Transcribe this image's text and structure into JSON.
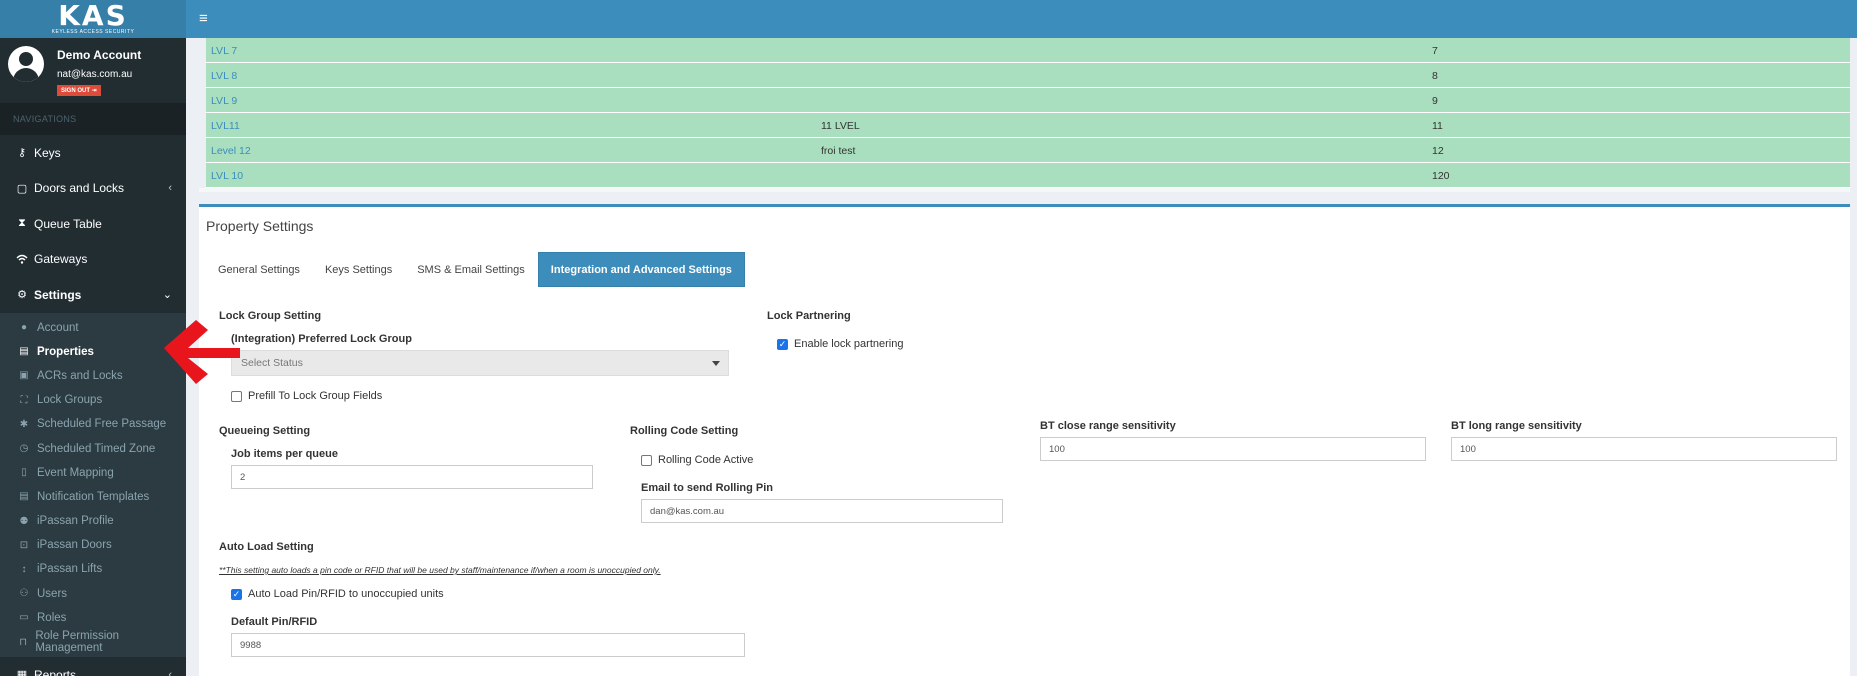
{
  "brand": {
    "logo": "KAS",
    "tagline": "KEYLESS ACCESS SECURITY"
  },
  "user": {
    "name": "Demo Account",
    "email": "nat@kas.com.au",
    "signout": "SIGN OUT ⇥"
  },
  "sidebar": {
    "header": "NAVIGATIONS",
    "items": [
      {
        "label": "Keys",
        "icon": "key-icon"
      },
      {
        "label": "Doors and Locks",
        "icon": "door-icon"
      },
      {
        "label": "Queue Table",
        "icon": "hourglass-icon"
      },
      {
        "label": "Gateways",
        "icon": "wifi-icon"
      },
      {
        "label": "Settings",
        "icon": "cogs-icon"
      }
    ],
    "settings_sub": [
      {
        "label": "Account",
        "icon": "user-icon"
      },
      {
        "label": "Properties",
        "icon": "building-icon"
      },
      {
        "label": "ACRs and Locks",
        "icon": "lock-icon"
      },
      {
        "label": "Lock Groups",
        "icon": "group-icon"
      },
      {
        "label": "Scheduled Free Passage",
        "icon": "asterisk-icon"
      },
      {
        "label": "Scheduled Timed Zone",
        "icon": "clock-icon"
      },
      {
        "label": "Event Mapping",
        "icon": "file-icon"
      },
      {
        "label": "Notification Templates",
        "icon": "document-icon"
      },
      {
        "label": "iPassan Profile",
        "icon": "user-plus-icon"
      },
      {
        "label": "iPassan Doors",
        "icon": "door-square-icon"
      },
      {
        "label": "iPassan Lifts",
        "icon": "lift-arrows-icon"
      },
      {
        "label": "Users",
        "icon": "users-icon"
      },
      {
        "label": "Roles",
        "icon": "id-card-icon"
      },
      {
        "label": "Role Permission Management",
        "icon": "unlock-icon"
      }
    ],
    "reports": {
      "label": "Reports",
      "icon": "report-icon"
    }
  },
  "floors": [
    {
      "name": "LVL 7",
      "desc": "",
      "level": "7"
    },
    {
      "name": "LVL 8",
      "desc": "",
      "level": "8"
    },
    {
      "name": "LVL 9",
      "desc": "",
      "level": "9"
    },
    {
      "name": "LVL11",
      "desc": "11 LVEL",
      "level": "11"
    },
    {
      "name": "Level 12",
      "desc": "froi test",
      "level": "12"
    },
    {
      "name": "LVL 10",
      "desc": "",
      "level": "120"
    }
  ],
  "property_settings": {
    "title": "Property Settings",
    "tabs": [
      "General Settings",
      "Keys Settings",
      "SMS & Email Settings",
      "Integration and Advanced Settings"
    ],
    "lock_group": {
      "title": "Lock Group Setting",
      "preferred_label": "(Integration) Preferred Lock Group",
      "select_value": "Select Status",
      "prefill_label": "Prefill To Lock Group Fields"
    },
    "lock_partnering": {
      "title": "Lock Partnering",
      "enable_label": "Enable lock partnering"
    },
    "queueing": {
      "title": "Queueing Setting",
      "job_label": "Job items per queue",
      "job_value": "2"
    },
    "rolling": {
      "title": "Rolling Code Setting",
      "active_label": "Rolling Code Active",
      "email_label": "Email to send Rolling Pin",
      "email_value": "dan@kas.com.au"
    },
    "bt_close": {
      "label": "BT close range sensitivity",
      "value": "100"
    },
    "bt_long": {
      "label": "BT long range sensitivity",
      "value": "100"
    },
    "auto_load": {
      "title": "Auto Load Setting",
      "note": "**This setting auto loads a pin code or RFID that will be used by staff/maintenance if/when a room is unoccupied only.",
      "check_label": "Auto Load Pin/RFID to unoccupied units",
      "default_label": "Default Pin/RFID",
      "default_value": "9988"
    }
  },
  "colors": {
    "sidebar": "#222d32",
    "topbar": "#3c8dbc",
    "row": "#a9dfbf",
    "arrow": "#e8161c"
  }
}
